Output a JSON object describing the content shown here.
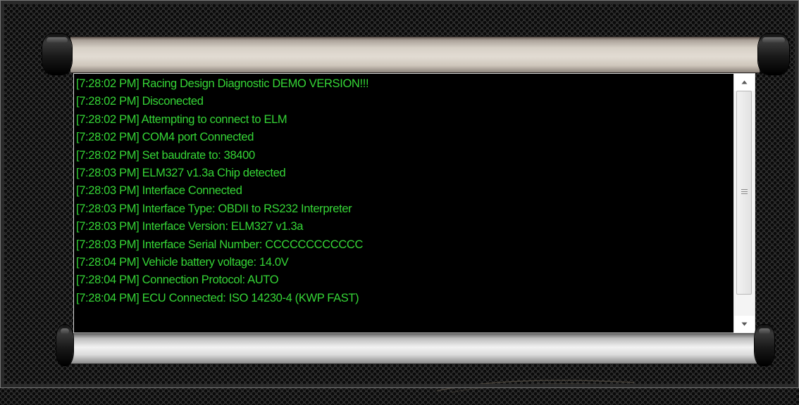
{
  "log": {
    "lines": [
      "[7:28:02 PM] Racing Design Diagnostic DEMO VERSION!!!",
      "[7:28:02 PM] Disconected",
      "[7:28:02 PM] Attempting to connect to ELM",
      "[7:28:02 PM] COM4 port Connected",
      "[7:28:02 PM] Set baudrate to: 38400",
      "[7:28:03 PM] ELM327 v1.3a Chip detected",
      "[7:28:03 PM] Interface Connected",
      "[7:28:03 PM] Interface Type: OBDII to RS232 Interpreter",
      "[7:28:03 PM] Interface Version: ELM327 v1.3a",
      "[7:28:03 PM] Interface Serial Number: CCCCCCCCCCCC",
      "[7:28:04 PM] Vehicle battery voltage: 14.0V",
      "[7:28:04 PM] Connection Protocol: AUTO",
      "[7:28:04 PM] ECU Connected: ISO 14230-4 (KWP FAST)"
    ]
  },
  "scrollbar": {
    "up_icon": "triangle-up-icon",
    "down_icon": "triangle-down-icon",
    "grip_icon": "grip-lines-icon"
  },
  "colors": {
    "log_text": "#35d636",
    "log_background": "#000000",
    "top_roller": "#e2dcd3",
    "bottom_roller": "#f2f2f2"
  }
}
